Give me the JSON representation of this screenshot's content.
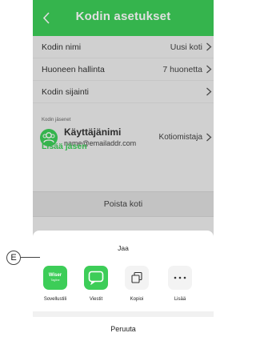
{
  "header": {
    "title": "Kodin asetukset"
  },
  "settings": [
    {
      "label": "Kodin nimi",
      "value": "Uusi koti"
    },
    {
      "label": "Huoneen hallinta",
      "value": "7 huonetta"
    },
    {
      "label": "Kodin sijainti",
      "value": ""
    }
  ],
  "members": {
    "section_label": "Kodin jäsenet",
    "list": [
      {
        "name": "Käyttäjänimi",
        "email": "name@emailaddr.com",
        "role": "Kotiomistaja"
      }
    ],
    "add_label": "Lisää jäsen"
  },
  "delete_home_label": "Poista koti",
  "share_sheet": {
    "title": "Jaa",
    "app_icon_text": "Wiser",
    "app_icon_sub": "Tagline",
    "items": [
      {
        "label": "Sovellustili",
        "icon": "app-icon"
      },
      {
        "label": "Viestit",
        "icon": "message-icon"
      },
      {
        "label": "Kopioi",
        "icon": "copy-icon"
      },
      {
        "label": "Lisää",
        "icon": "more-icon"
      }
    ],
    "cancel_label": "Peruuta"
  },
  "callout": {
    "label": "E"
  },
  "colors": {
    "accent": "#3dcd58",
    "background": "#ededed"
  }
}
